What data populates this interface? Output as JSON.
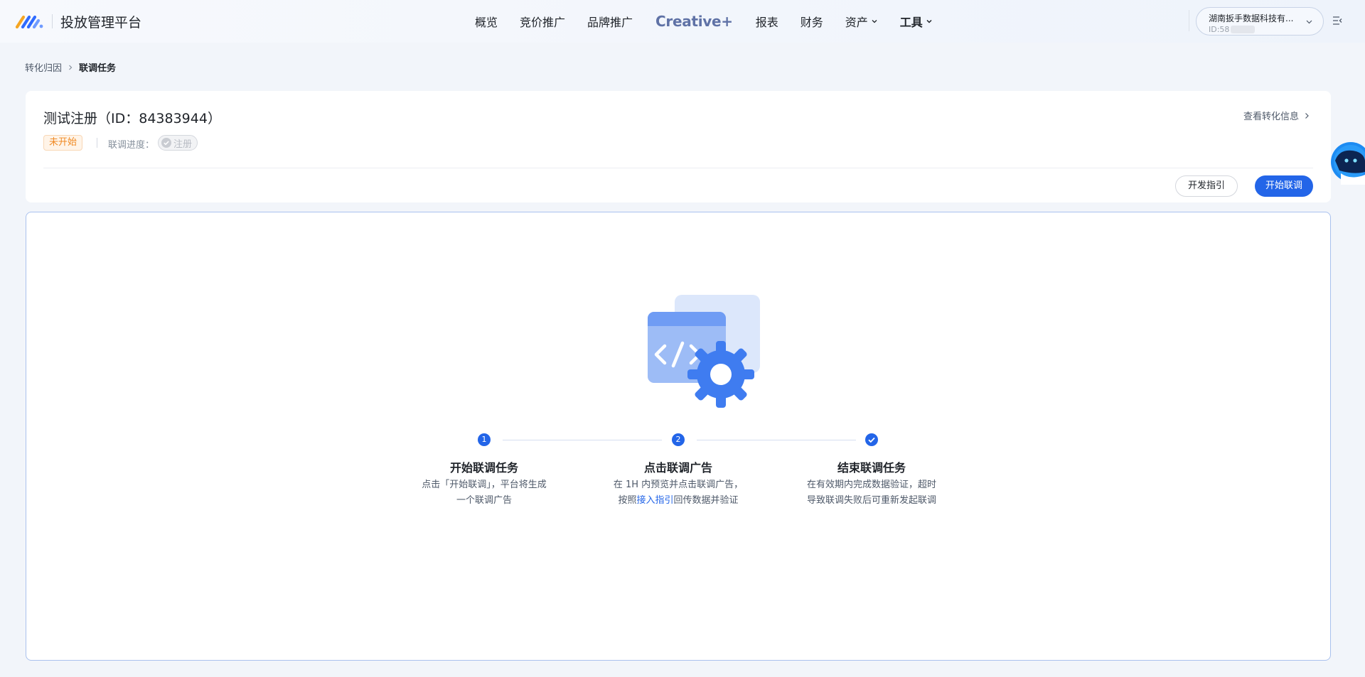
{
  "nav": {
    "platform_name": "投放管理平台",
    "menu": [
      {
        "label": "概览"
      },
      {
        "label": "竞价推广"
      },
      {
        "label": "品牌推广"
      },
      {
        "label": "Creative"
      },
      {
        "label": "报表"
      },
      {
        "label": "财务"
      },
      {
        "label": "资产"
      },
      {
        "label": "工具"
      }
    ],
    "creative_mark": "+",
    "account_name": "湖南扳手数据科技有...",
    "account_id": "ID:58"
  },
  "breadcrumb": {
    "parent": "转化归因",
    "current": "联调任务"
  },
  "task": {
    "title": "测试注册（ID：84383944）",
    "status": "未开始",
    "progress_label": "联调进度：",
    "event": "注册",
    "view_conversion": "查看转化信息",
    "guide_button": "开发指引",
    "start_button": "开始联调"
  },
  "steps": [
    {
      "number": "1",
      "title": "开始联调任务",
      "desc_line1": "点击「开始联调」，平台将生成",
      "desc_line2": "一个联调广告"
    },
    {
      "number": "2",
      "title": "点击联调广告",
      "desc_line1": "在 1H 内预览并点击联调广告，",
      "desc_line2_pre": "按照",
      "desc_link": "接入指引",
      "desc_line2_post": "回传数据并验证"
    },
    {
      "title": "结束联调任务",
      "desc_line1": "在有效期内完成数据验证，超时",
      "desc_line2": "导致联调失败后可重新发起联调"
    }
  ],
  "colors": {
    "primary": "#2365e8",
    "warning": "#f08a24",
    "panel_border": "#a9c1ee"
  }
}
